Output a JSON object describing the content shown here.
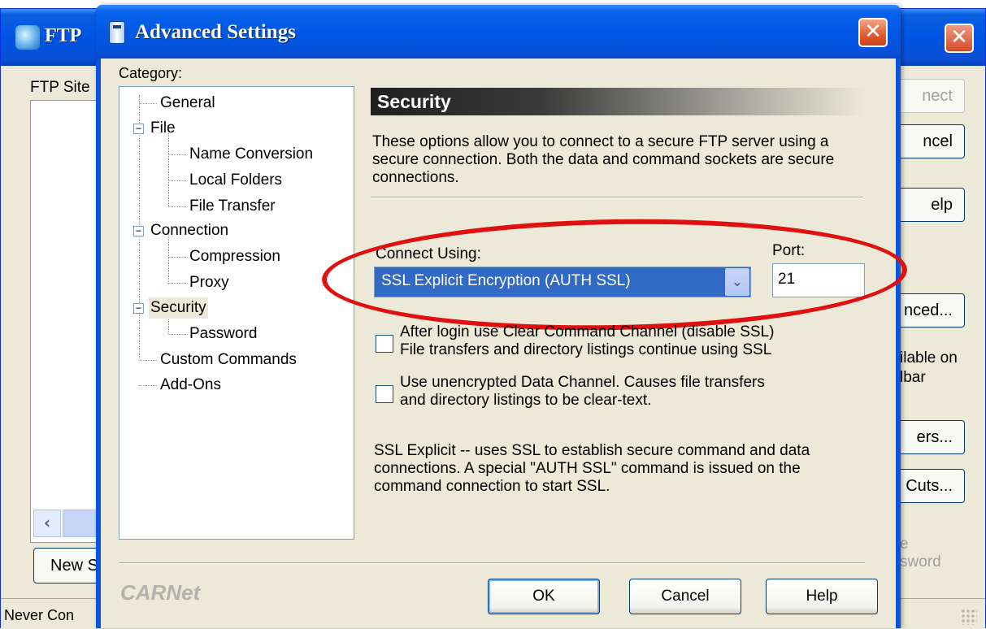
{
  "bg_window": {
    "title": "FTP",
    "close_glyph": "✕",
    "ftp_sites_label": "FTP Site",
    "new_button": "New S",
    "right_buttons": {
      "connect": "nect",
      "cancel": "ncel",
      "help": "elp",
      "advanced": "nced...",
      "filters": "ers...",
      "shortcuts": "Cuts..."
    },
    "available_text_1": "ilable on",
    "available_text_2": "lbar",
    "gray_text_1": "e",
    "gray_text_2": "sword",
    "status_text": "Never Con"
  },
  "dialog": {
    "title": "Advanced Settings",
    "close_glyph": "✕",
    "category_label": "Category:",
    "tree": {
      "general": "General",
      "file": "File",
      "name_conversion": "Name Conversion",
      "local_folders": "Local Folders",
      "file_transfer": "File Transfer",
      "connection": "Connection",
      "compression": "Compression",
      "proxy": "Proxy",
      "security": "Security",
      "password": "Password",
      "custom_commands": "Custom Commands",
      "add_ons": "Add-Ons",
      "expander_glyph": "−"
    },
    "panel": {
      "header": "Security",
      "description": "These options allow you to connect to a secure FTP server using a secure connection.  Both the data and command sockets are secure connections.",
      "connect_using_label": "Connect Using:",
      "connect_using_value": "SSL Explicit Encryption (AUTH SSL)",
      "dropdown_arrow": "⌄",
      "port_label": "Port:",
      "port_value": "21",
      "option1_line1": "After login use Clear Command Channel (disable SSL)",
      "option1_line2": "File transfers and directory listings continue using SSL",
      "option2_line1": "Use unencrypted Data Channel.  Causes file transfers",
      "option2_line2": "and directory listings to be clear-text.",
      "ssl_explanation": "SSL Explicit -- uses SSL to establish secure command and data connections.  A special \"AUTH SSL\" command is issued on the command connection to start SSL."
    },
    "footer": {
      "logo": "CARNet",
      "ok": "OK",
      "cancel": "Cancel",
      "help": "Help"
    }
  },
  "colors": {
    "titlebar_blue": "#0054e3",
    "selection_blue": "#316ac5",
    "dialog_face": "#ece9d8",
    "annotation_red": "#e01010"
  }
}
